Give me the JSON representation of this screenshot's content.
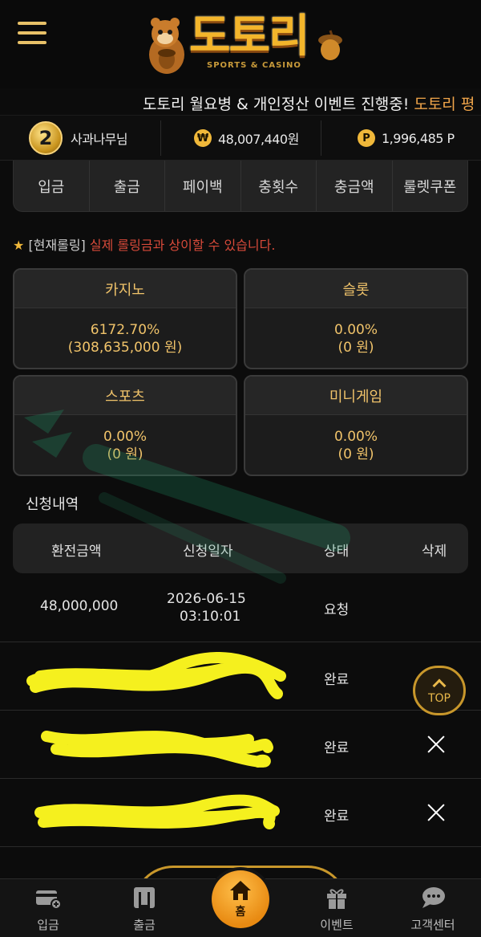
{
  "header": {
    "logo_text": "도토리",
    "logo_sub": "SPORTS & CASINO"
  },
  "ticker": {
    "part1": "도토리 월요병 & 개인정산 이벤트 진행중!",
    "part2": " 도토리 평"
  },
  "user": {
    "level": "2",
    "name": "사과나무님",
    "currency_symbol": "₩",
    "balance": "48,007,440원",
    "point_symbol": "P",
    "points": "1,996,485 P"
  },
  "tabs": [
    "입금",
    "출금",
    "페이백",
    "충횟수",
    "충금액",
    "룰렛쿠폰"
  ],
  "notice": {
    "star": "★",
    "bracket": "[현재롤링]",
    "text": " 실제 롤링금과 상이할 수 있습니다."
  },
  "rolling": [
    {
      "label": "카지노",
      "percent": "6172.70%",
      "amount": "(308,635,000 원)"
    },
    {
      "label": "슬롯",
      "percent": "0.00%",
      "amount": "(0 원)"
    },
    {
      "label": "스포츠",
      "percent": "0.00%",
      "amount": "(0 원)"
    },
    {
      "label": "미니게임",
      "percent": "0.00%",
      "amount": "(0 원)"
    }
  ],
  "history": {
    "title": "신청내역",
    "columns": [
      "환전금액",
      "신청일자",
      "상태",
      "삭제"
    ],
    "rows": [
      {
        "amount": "48,000,000",
        "date": "2026-06-15",
        "time": "03:10:01",
        "status": "요청",
        "deletable": false
      },
      {
        "amount": "",
        "date": "",
        "time": "",
        "status": "완료",
        "deletable": false
      },
      {
        "amount": "",
        "date": "",
        "time": "",
        "status": "완료",
        "deletable": true
      },
      {
        "amount": "",
        "date": "",
        "time": "",
        "status": "완료",
        "deletable": true
      }
    ]
  },
  "top_button": {
    "label": "TOP"
  },
  "bottom_nav": [
    {
      "label": "입금",
      "icon": "deposit-card-icon"
    },
    {
      "label": "출금",
      "icon": "withdraw-atm-icon"
    },
    {
      "label": "홈",
      "icon": "home-icon"
    },
    {
      "label": "이벤트",
      "icon": "gift-icon"
    },
    {
      "label": "고객센터",
      "icon": "chat-bubble-icon"
    }
  ],
  "colors": {
    "accent_gold": "#f0c36a",
    "logo_orange": "#f3b52b",
    "warning_red": "#d84a3a",
    "ticker_orange": "#f0a54a",
    "scribble_yellow": "#f5f01e"
  }
}
